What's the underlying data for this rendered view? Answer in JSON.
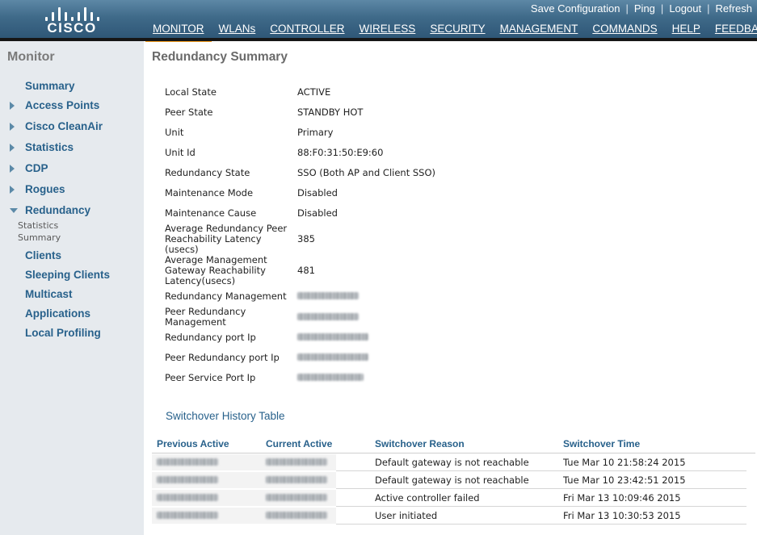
{
  "brand": {
    "logo_text": "CISCO"
  },
  "util_links": [
    "Save Configuration",
    "Ping",
    "Logout",
    "Refresh"
  ],
  "nav": [
    {
      "label": "MONITOR",
      "active": true
    },
    {
      "label": "WLANs",
      "active": false
    },
    {
      "label": "CONTROLLER",
      "active": false
    },
    {
      "label": "WIRELESS",
      "active": false
    },
    {
      "label": "SECURITY",
      "active": false
    },
    {
      "label": "MANAGEMENT",
      "active": false
    },
    {
      "label": "COMMANDS",
      "active": false
    },
    {
      "label": "HELP",
      "active": false
    },
    {
      "label": "FEEDBACK",
      "active": false
    }
  ],
  "sidebar": {
    "title": "Monitor",
    "items": [
      {
        "label": "Summary"
      },
      {
        "label": "Access Points"
      },
      {
        "label": "Cisco CleanAir"
      },
      {
        "label": "Statistics"
      },
      {
        "label": "CDP"
      },
      {
        "label": "Rogues"
      },
      {
        "label": "Redundancy"
      },
      {
        "label": "Clients"
      },
      {
        "label": "Sleeping Clients"
      },
      {
        "label": "Multicast"
      },
      {
        "label": "Applications"
      },
      {
        "label": "Local Profiling"
      }
    ],
    "sub_items": [
      "Statistics",
      "Summary"
    ]
  },
  "page_title": "Redundancy Summary",
  "fields": [
    {
      "label": "Local State",
      "value": "ACTIVE"
    },
    {
      "label": "Peer State",
      "value": "STANDBY HOT"
    },
    {
      "label": "Unit",
      "value": "Primary"
    },
    {
      "label": "Unit Id",
      "value": "88:F0:31:50:E9:60"
    },
    {
      "label": "Redundancy State",
      "value": "SSO (Both AP and Client SSO)"
    },
    {
      "label": "Maintenance Mode",
      "value": "Disabled"
    },
    {
      "label": "Maintenance Cause",
      "value": "Disabled"
    },
    {
      "label": "Average Redundancy Peer Reachability Latency (usecs)",
      "value": "385"
    },
    {
      "label": "Average Management Gateway Reachability Latency(usecs)",
      "value": "481"
    },
    {
      "label": "Redundancy Management",
      "value": ""
    },
    {
      "label": "Peer Redundancy Management",
      "value": ""
    },
    {
      "label": "Redundancy port Ip",
      "value": ""
    },
    {
      "label": "Peer Redundancy port Ip",
      "value": ""
    },
    {
      "label": "Peer Service Port Ip",
      "value": ""
    }
  ],
  "history": {
    "title": "Switchover History Table",
    "headers": [
      "Previous Active",
      "Current Active",
      "Switchover Reason",
      "Switchover Time"
    ],
    "rows": [
      {
        "reason": "Default gateway is not reachable",
        "time": "Tue Mar 10 21:58:24 2015"
      },
      {
        "reason": "Default gateway is not reachable",
        "time": "Tue Mar 10 23:42:51 2015"
      },
      {
        "reason": "Active controller failed",
        "time": "Fri Mar 13 10:09:46 2015"
      },
      {
        "reason": "User initiated",
        "time": "Fri Mar 13 10:30:53 2015"
      }
    ]
  }
}
